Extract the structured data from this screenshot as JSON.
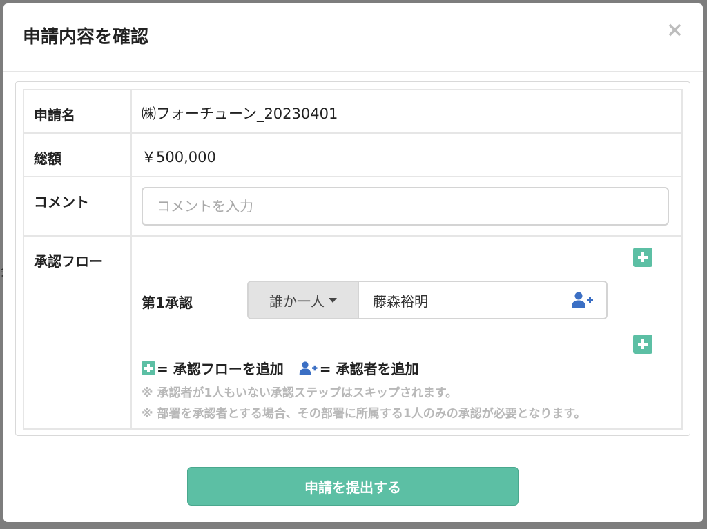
{
  "modal": {
    "title": "申請内容を確認",
    "close_label": "×"
  },
  "fields": {
    "name_label": "申請名",
    "name_value": "㈱フォーチューン_20230401",
    "total_label": "総額",
    "total_value": "￥500,000",
    "comment_label": "コメント",
    "comment_placeholder": "コメントを入力",
    "flow_label": "承認フロー"
  },
  "flow": {
    "steps": [
      {
        "label": "第1承認",
        "approver_type": "誰か一人",
        "approver_name": "藤森裕明"
      }
    ],
    "legend_add_flow": "= 承認フローを追加",
    "legend_add_approver": "= 承認者を追加",
    "notes": [
      "※ 承認者が1人もいない承認ステップはスキップされます。",
      "※ 部署を承認者とする場合、その部署に所属する1人のみの承認が必要となります。"
    ]
  },
  "footer": {
    "submit_label": "申請を提出する"
  },
  "colors": {
    "accent": "#5cbfa4",
    "icon_blue": "#3b6fc4"
  }
}
